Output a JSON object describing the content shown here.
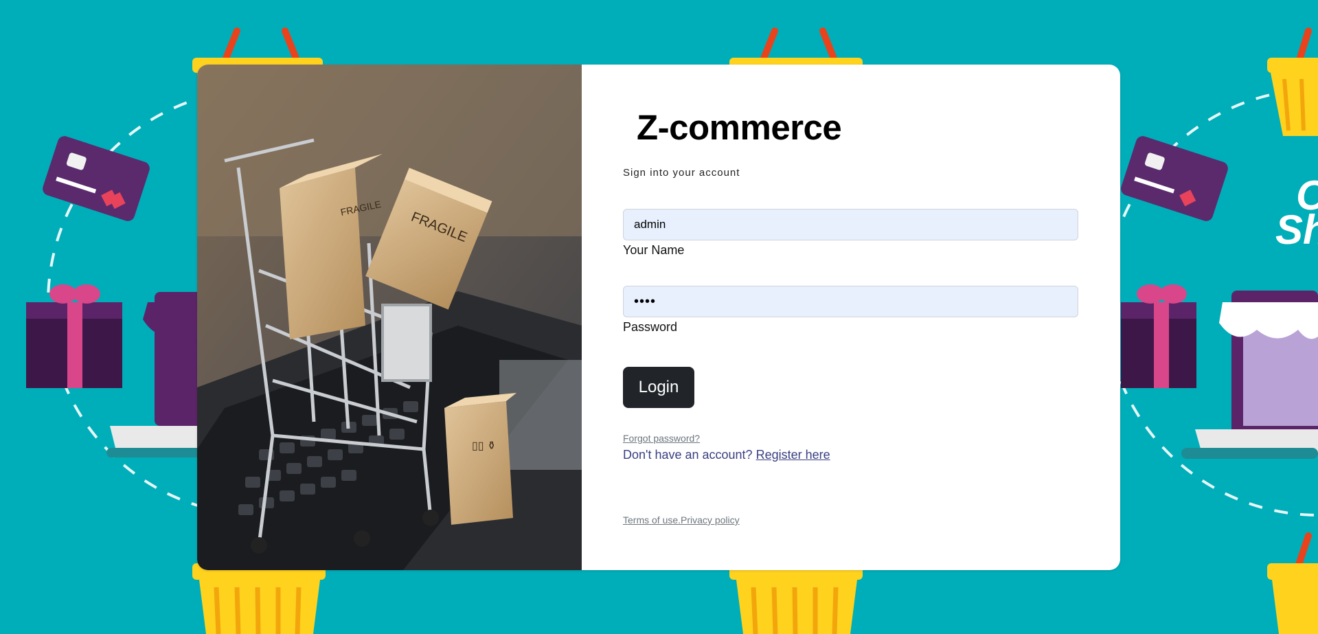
{
  "brand": {
    "name": "Z-commerce"
  },
  "form": {
    "subtitle": "Sign into your account",
    "name_value": "admin",
    "name_label": "Your Name",
    "password_value": "••••",
    "password_label": "Password",
    "login_label": "Login"
  },
  "links": {
    "forgot_password": "Forgot password?",
    "no_account_text": "Don't have an account?",
    "register": "Register here",
    "terms": "Terms of use.",
    "privacy": "Privacy policy"
  },
  "background": {
    "teal": "#00aeb9",
    "decorations": [
      "shopping-basket-icon",
      "credit-card-icon",
      "gift-box-icon",
      "laptop-store-icon"
    ]
  },
  "colors": {
    "button": "#212529",
    "input_bg": "#e8f0fe",
    "link": "#393f81",
    "muted": "#6c757d"
  }
}
